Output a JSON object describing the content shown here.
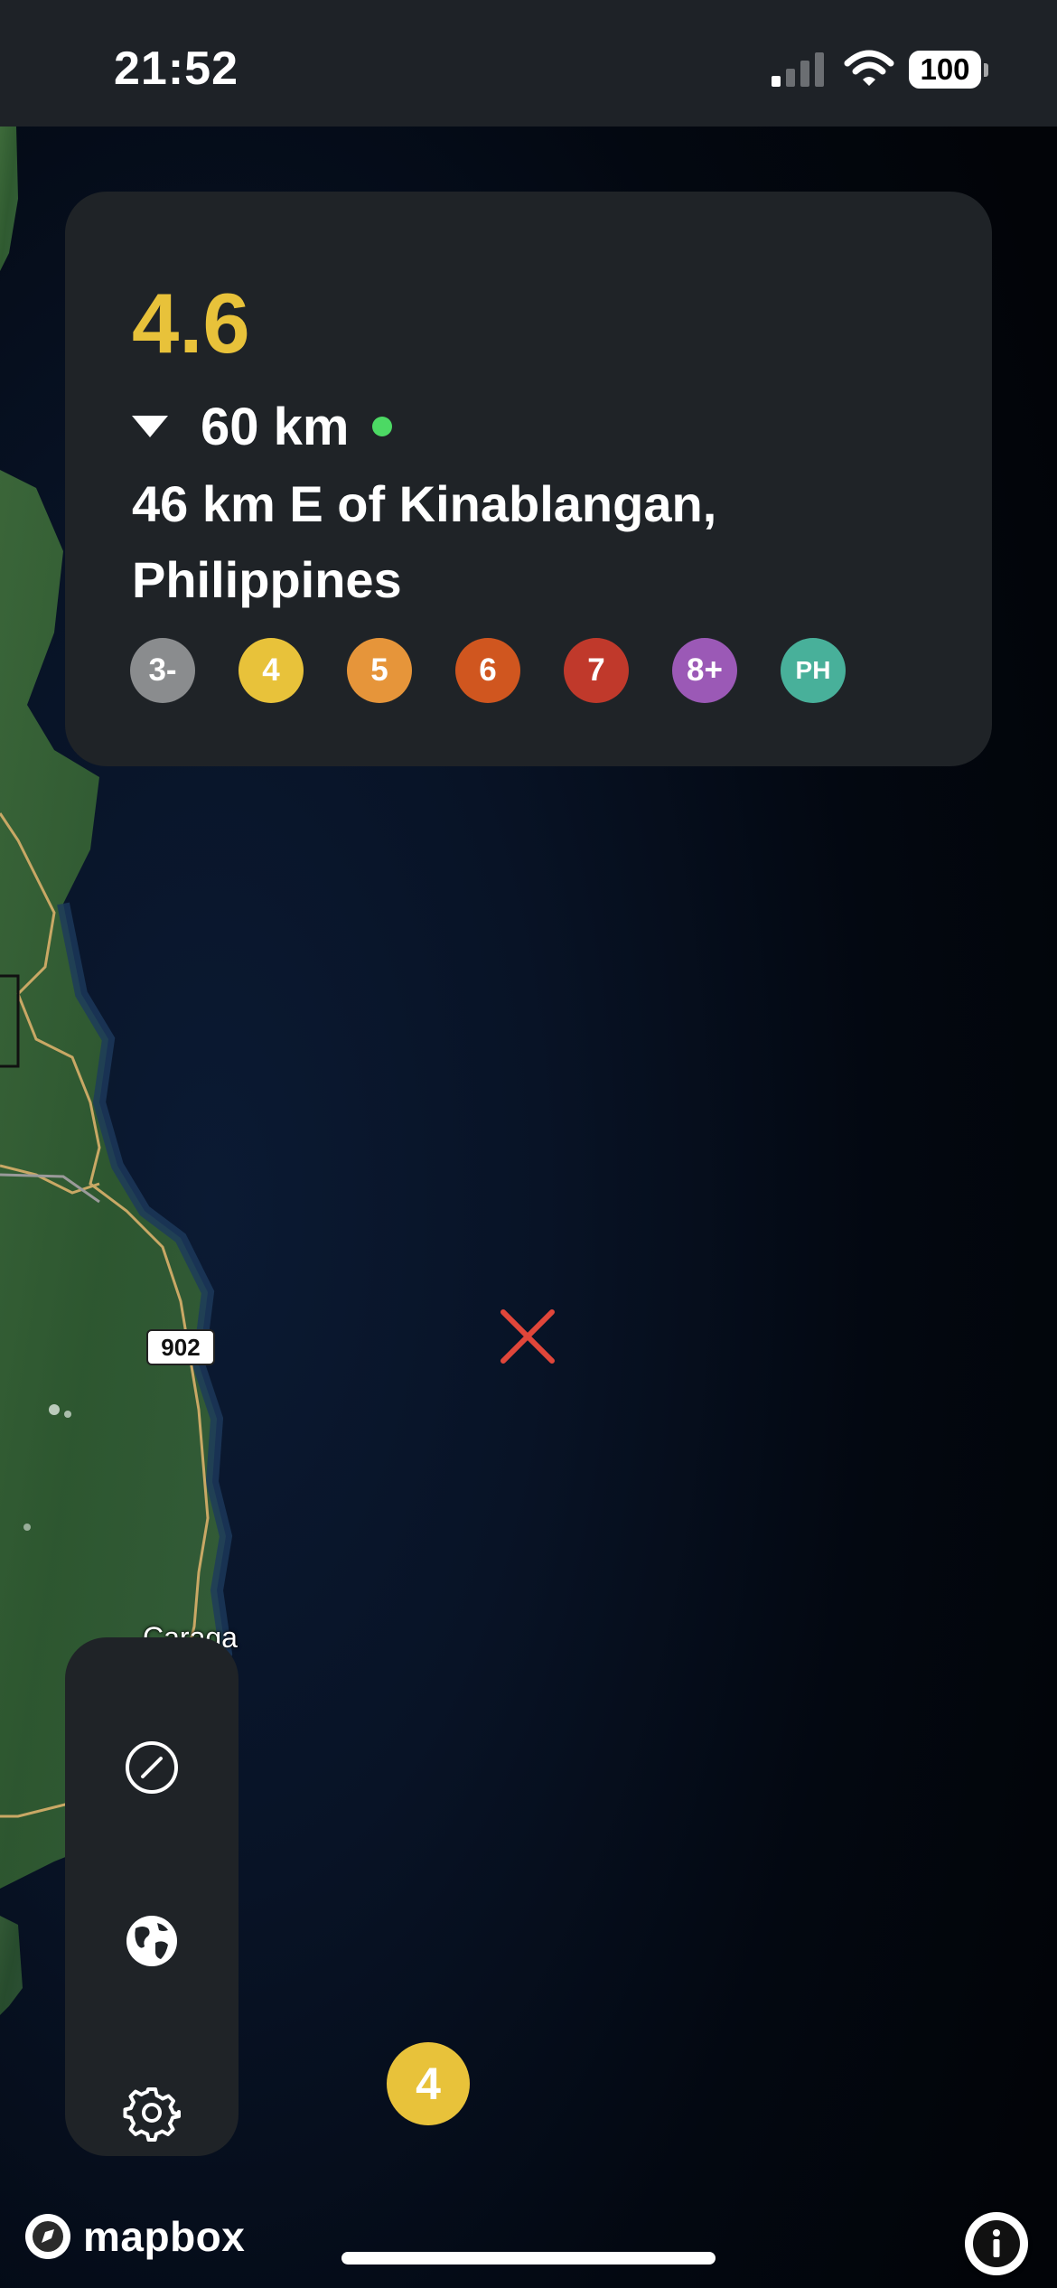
{
  "status_bar": {
    "time": "21:52",
    "battery": "100"
  },
  "quake": {
    "magnitude": "4.6",
    "depth": "60 km",
    "location": "46 km E of Kinablangan, Philippines"
  },
  "magnitude_filters": [
    {
      "label": "3-",
      "color": "#8a8c8e"
    },
    {
      "label": "4",
      "color": "#e8c23a"
    },
    {
      "label": "5",
      "color": "#e6953a"
    },
    {
      "label": "6",
      "color": "#d0561f"
    },
    {
      "label": "7",
      "color": "#c0392b"
    },
    {
      "label": "8+",
      "color": "#9b59b6"
    },
    {
      "label": "PH",
      "color": "#48b09a"
    }
  ],
  "map": {
    "route_shield": "902",
    "place_label": "Caraga",
    "quake_bubble_label": "4"
  },
  "toolbar": {
    "items": [
      {
        "icon": "slash-circle-icon"
      },
      {
        "icon": "globe-icon"
      },
      {
        "icon": "gear-icon"
      }
    ]
  },
  "attribution": {
    "logo_text": "mapbox"
  },
  "colors": {
    "magnitude_accent": "#e8c23a",
    "live_indicator": "#4cd964",
    "epicenter": "#e0463a",
    "card_background": "#1f2327"
  }
}
